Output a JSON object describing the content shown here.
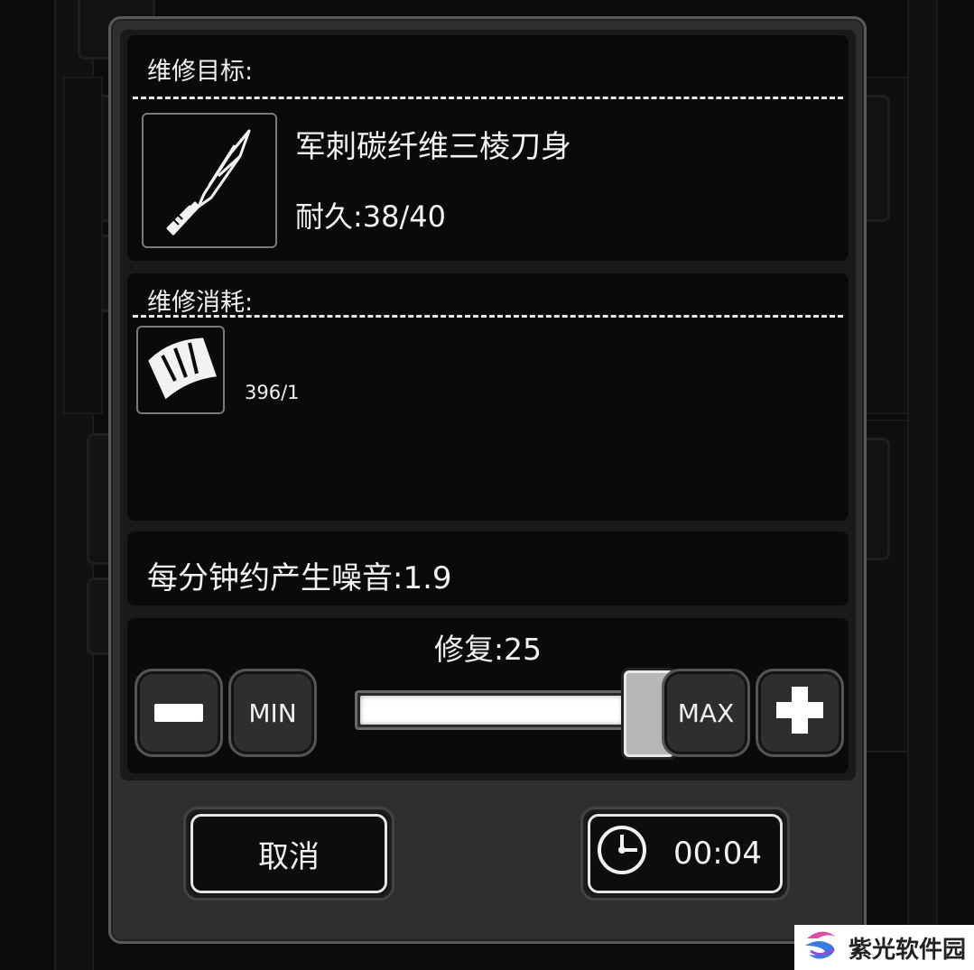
{
  "target_section": {
    "title": "维修目标:",
    "item_name": "军刺碳纤维三棱刀身",
    "durability": "耐久:38/40",
    "icon": "blade-icon"
  },
  "cost_section": {
    "title": "维修消耗:",
    "material_icon": "carbon-fiber-sheet-icon",
    "material_count": "396/1"
  },
  "noise_text": "每分钟约产生噪音:1.9",
  "repair": {
    "label": "修复:25",
    "min_label": "MIN",
    "max_label": "MAX",
    "slider_fraction": 1.0
  },
  "buttons": {
    "cancel_label": "取消",
    "timer_label": "00:04",
    "timer_icon": "clock-icon"
  },
  "watermark": {
    "text": "紫光软件园"
  },
  "colors": {
    "panel": "#2f2f2f",
    "section": "#0a0a0a",
    "accent": "#ffffff"
  }
}
